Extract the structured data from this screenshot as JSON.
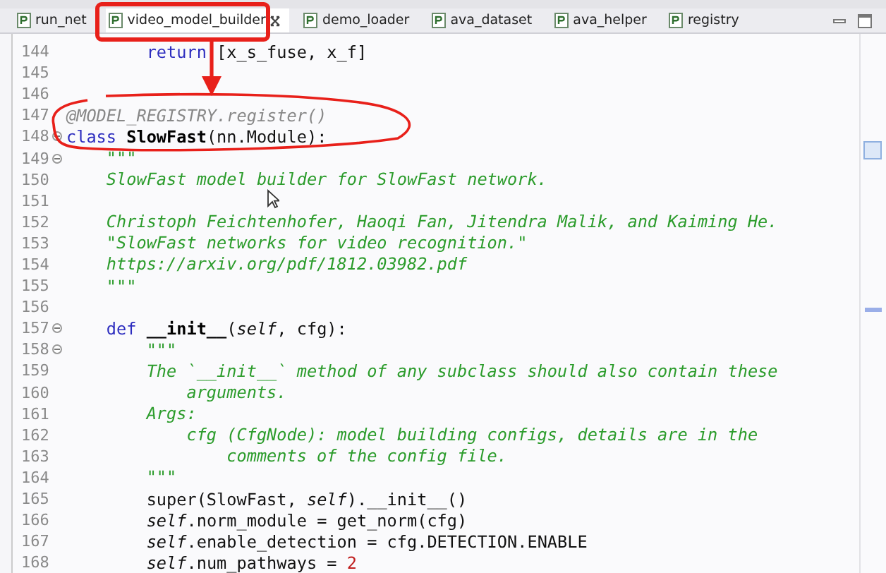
{
  "tabs": [
    {
      "label": "run_net",
      "selected": false
    },
    {
      "label": "video_model_builder",
      "selected": true
    },
    {
      "label": "demo_loader",
      "selected": false
    },
    {
      "label": "ava_dataset",
      "selected": false
    },
    {
      "label": "ava_helper",
      "selected": false
    },
    {
      "label": "registry",
      "selected": false
    }
  ],
  "lines": [
    {
      "n": "144",
      "fold": false,
      "tokens": [
        {
          "t": "        return",
          "kind": "kw"
        },
        {
          "t": " [x_s_fuse, x_f]",
          "kind": "plain"
        }
      ]
    },
    {
      "n": "145",
      "fold": false
    },
    {
      "n": "146",
      "fold": false
    },
    {
      "n": "147",
      "fold": false,
      "tokens": [
        {
          "t": "@MODEL_REGISTRY.register()",
          "kind": "decorator"
        }
      ]
    },
    {
      "n": "148",
      "fold": true,
      "tokens": [
        {
          "t": "class",
          "kind": "kw"
        },
        {
          "t": " SlowFast",
          "kind": "defname"
        },
        {
          "t": "(nn.Module):",
          "kind": "plain"
        }
      ]
    },
    {
      "n": "149",
      "fold": true,
      "tokens": [
        {
          "t": "    \"\"\"",
          "kind": "doc"
        }
      ]
    },
    {
      "n": "150",
      "fold": false,
      "tokens": [
        {
          "t": "    SlowFast model builder for SlowFast network.",
          "kind": "doc"
        }
      ]
    },
    {
      "n": "151",
      "fold": false
    },
    {
      "n": "152",
      "fold": false,
      "tokens": [
        {
          "t": "    Christoph Feichtenhofer, Haoqi Fan, Jitendra Malik, and Kaiming He.",
          "kind": "doc"
        }
      ]
    },
    {
      "n": "153",
      "fold": false,
      "tokens": [
        {
          "t": "    \"SlowFast networks for video recognition.\"",
          "kind": "doc"
        }
      ]
    },
    {
      "n": "154",
      "fold": false,
      "tokens": [
        {
          "t": "    https://arxiv.org/pdf/1812.03982.pdf",
          "kind": "doc"
        }
      ]
    },
    {
      "n": "155",
      "fold": false,
      "tokens": [
        {
          "t": "    \"\"\"",
          "kind": "doc"
        }
      ]
    },
    {
      "n": "156",
      "fold": false
    },
    {
      "n": "157",
      "fold": true,
      "tokens": [
        {
          "t": "    def",
          "kind": "kw"
        },
        {
          "t": " __init__",
          "kind": "defname"
        },
        {
          "t": "(",
          "kind": "plain"
        },
        {
          "t": "self",
          "kind": "self"
        },
        {
          "t": ", cfg):",
          "kind": "plain"
        }
      ]
    },
    {
      "n": "158",
      "fold": true,
      "tokens": [
        {
          "t": "        \"\"\"",
          "kind": "doc"
        }
      ]
    },
    {
      "n": "159",
      "fold": false,
      "tokens": [
        {
          "t": "        The `__init__` method of any subclass should also contain these",
          "kind": "doc"
        }
      ]
    },
    {
      "n": "160",
      "fold": false,
      "tokens": [
        {
          "t": "            arguments.",
          "kind": "doc"
        }
      ]
    },
    {
      "n": "161",
      "fold": false,
      "tokens": [
        {
          "t": "        Args:",
          "kind": "doc"
        }
      ]
    },
    {
      "n": "162",
      "fold": false,
      "tokens": [
        {
          "t": "            cfg (CfgNode): model building configs, details are in the",
          "kind": "doc"
        }
      ]
    },
    {
      "n": "163",
      "fold": false,
      "tokens": [
        {
          "t": "                comments of the config file.",
          "kind": "doc"
        }
      ]
    },
    {
      "n": "164",
      "fold": false,
      "tokens": [
        {
          "t": "        \"\"\"",
          "kind": "doc"
        }
      ]
    },
    {
      "n": "165",
      "fold": false,
      "tokens": [
        {
          "t": "        super(SlowFast, ",
          "kind": "plain"
        },
        {
          "t": "self",
          "kind": "self"
        },
        {
          "t": ").__init__()",
          "kind": "plain"
        }
      ]
    },
    {
      "n": "166",
      "fold": false,
      "tokens": [
        {
          "t": "        self",
          "kind": "self"
        },
        {
          "t": ".norm_module = get_norm(cfg)",
          "kind": "plain"
        }
      ]
    },
    {
      "n": "167",
      "fold": false,
      "tokens": [
        {
          "t": "        self",
          "kind": "self"
        },
        {
          "t": ".enable_detection = cfg.DETECTION.ENABLE",
          "kind": "plain"
        }
      ]
    },
    {
      "n": "168",
      "fold": false,
      "tokens": [
        {
          "t": "        self",
          "kind": "self"
        },
        {
          "t": ".num_pathways = ",
          "kind": "plain"
        },
        {
          "t": "2",
          "kind": "number"
        }
      ]
    }
  ]
}
